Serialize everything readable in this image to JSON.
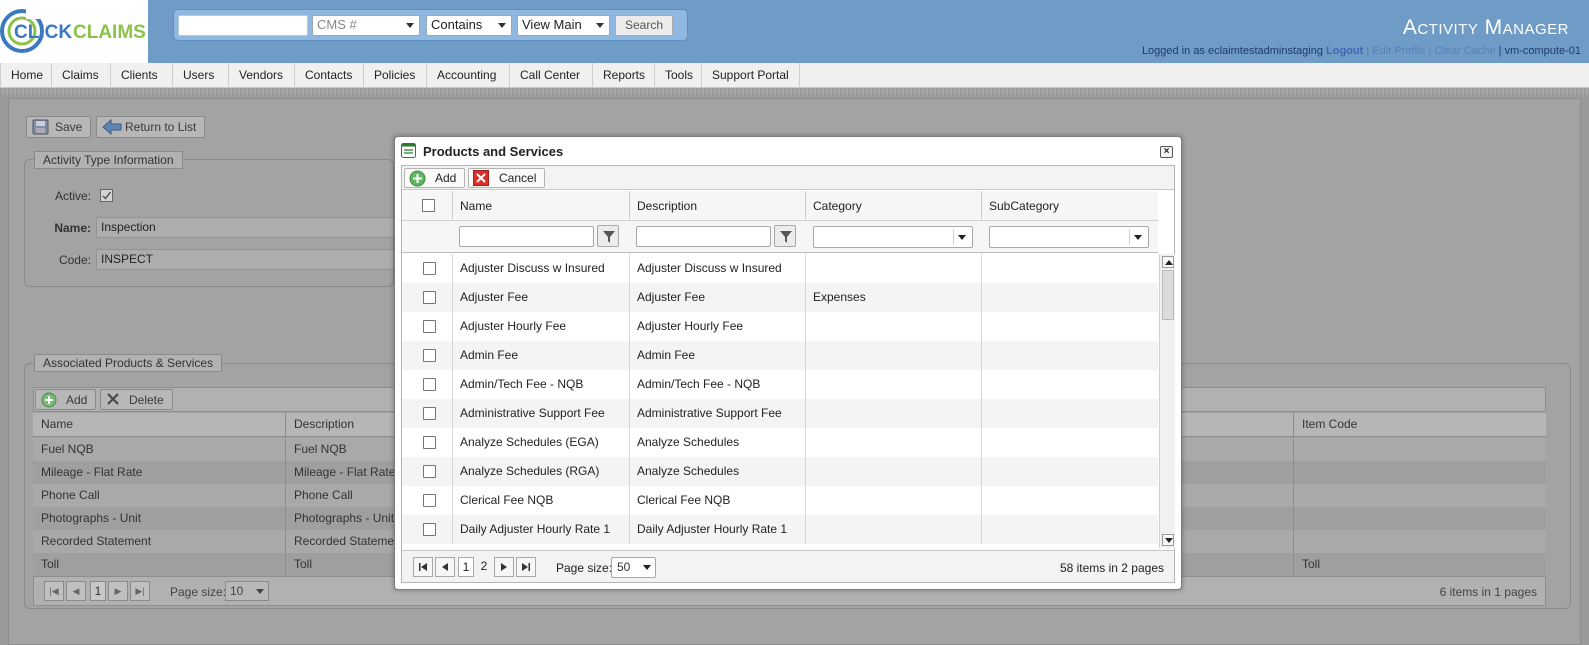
{
  "header": {
    "logo_text": "CLICKCLAIMS",
    "app_title": "Activity Manager",
    "search_value": "",
    "search_type": "CMS #",
    "match_mode": "Contains",
    "view_mode": "View Main",
    "search_label": "Search",
    "logged_in_prefix": "Logged in as eclaimtestadminstaging",
    "logout_label": "Logout",
    "edit_profile_label": "Edit Profile",
    "clear_cache_label": "Clear Cache",
    "server_name": "vm-compute-01",
    "separator": "|"
  },
  "menu": [
    "Home",
    "Claims",
    "Clients",
    "Users",
    "Vendors",
    "Contacts",
    "Policies",
    "Accounting",
    "Call Center",
    "Reports",
    "Tools",
    "Support Portal"
  ],
  "page": {
    "save_label": "Save",
    "return_label": "Return to List",
    "section_title": "Activity Type Information",
    "active_label": "Active:",
    "active_checked": true,
    "name_label": "Name:",
    "name_value": "Inspection",
    "code_label": "Code:",
    "code_value": "INSPECT",
    "assoc_title": "Associated Products & Services",
    "add_label": "Add",
    "delete_label": "Delete",
    "columns": [
      "Name",
      "Description",
      "Item Code"
    ],
    "rows": [
      {
        "name": "Fuel NQB",
        "desc": "Fuel NQB",
        "code": ""
      },
      {
        "name": "Mileage - Flat Rate",
        "desc": "Mileage - Flat Rate",
        "code": ""
      },
      {
        "name": "Phone Call",
        "desc": "Phone Call",
        "code": ""
      },
      {
        "name": "Photographs - Unit",
        "desc": "Photographs - Unit",
        "code": ""
      },
      {
        "name": "Recorded Statement",
        "desc": "Recorded Statement",
        "code": ""
      },
      {
        "name": "Toll",
        "desc": "Toll",
        "code": "Toll"
      }
    ],
    "pager_page": "1",
    "page_size_label": "Page size:",
    "page_size": "10",
    "summary": "6 items in 1 pages"
  },
  "modal": {
    "title": "Products and Services",
    "add_label": "Add",
    "cancel_label": "Cancel",
    "columns": [
      "Name",
      "Description",
      "Category",
      "SubCategory"
    ],
    "rows": [
      {
        "name": "Adjuster Discuss w Insured",
        "desc": "Adjuster Discuss w Insured",
        "category": "",
        "subcategory": ""
      },
      {
        "name": "Adjuster Fee",
        "desc": "Adjuster Fee",
        "category": "Expenses",
        "subcategory": ""
      },
      {
        "name": "Adjuster Hourly Fee",
        "desc": "Adjuster Hourly Fee",
        "category": "",
        "subcategory": ""
      },
      {
        "name": "Admin Fee",
        "desc": "Admin Fee",
        "category": "",
        "subcategory": ""
      },
      {
        "name": "Admin/Tech Fee - NQB",
        "desc": "Admin/Tech Fee - NQB",
        "category": "",
        "subcategory": ""
      },
      {
        "name": "Administrative Support Fee",
        "desc": "Administrative Support Fee",
        "category": "",
        "subcategory": ""
      },
      {
        "name": "Analyze Schedules (EGA)",
        "desc": "Analyze Schedules",
        "category": "",
        "subcategory": ""
      },
      {
        "name": "Analyze Schedules (RGA)",
        "desc": "Analyze Schedules",
        "category": "",
        "subcategory": ""
      },
      {
        "name": "Clerical Fee NQB",
        "desc": "Clerical Fee NQB",
        "category": "",
        "subcategory": ""
      },
      {
        "name": "Daily Adjuster Hourly Rate 1",
        "desc": "Daily Adjuster Hourly Rate 1",
        "category": "",
        "subcategory": ""
      }
    ],
    "pages": [
      "1",
      "2"
    ],
    "page_size_label": "Page size:",
    "page_size": "50",
    "summary": "58 items in 2 pages"
  },
  "colors": {
    "header_blue": "#6f9cc7",
    "brand_blue": "#3b78c2",
    "brand_green": "#8bc34a",
    "add_green": "#5cb85c",
    "cancel_red": "#d9302c"
  }
}
